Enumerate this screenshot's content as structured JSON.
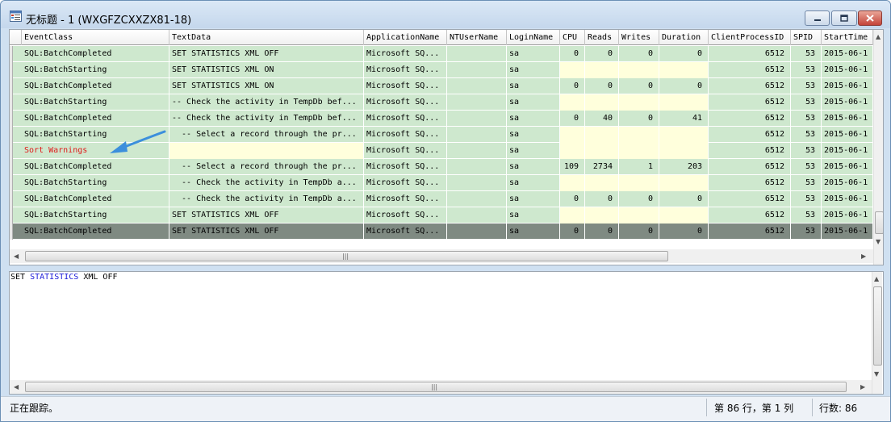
{
  "window": {
    "title": "无标题 - 1 (WXGFZCXXZX81-18)"
  },
  "columns": [
    "EventClass",
    "TextData",
    "ApplicationName",
    "NTUserName",
    "LoginName",
    "CPU",
    "Reads",
    "Writes",
    "Duration",
    "ClientProcessID",
    "SPID",
    "StartTime"
  ],
  "rows": [
    {
      "event": "SQL:BatchCompleted",
      "text": "SET STATISTICS XML OFF",
      "app": "Microsoft SQ...",
      "nt": "",
      "login": "sa",
      "cpu": "0",
      "reads": "0",
      "writes": "0",
      "duration": "0",
      "pid": "6512",
      "spid": "53",
      "start": "2015-06-1"
    },
    {
      "event": "SQL:BatchStarting",
      "text": "SET STATISTICS XML ON",
      "app": "Microsoft SQ...",
      "nt": "",
      "login": "sa",
      "cpu": "",
      "reads": "",
      "writes": "",
      "duration": "",
      "pid": "6512",
      "spid": "53",
      "start": "2015-06-1"
    },
    {
      "event": "SQL:BatchCompleted",
      "text": "SET STATISTICS XML ON",
      "app": "Microsoft SQ...",
      "nt": "",
      "login": "sa",
      "cpu": "0",
      "reads": "0",
      "writes": "0",
      "duration": "0",
      "pid": "6512",
      "spid": "53",
      "start": "2015-06-1"
    },
    {
      "event": "SQL:BatchStarting",
      "text": "-- Check the activity in TempDb bef...",
      "app": "Microsoft SQ...",
      "nt": "",
      "login": "sa",
      "cpu": "",
      "reads": "",
      "writes": "",
      "duration": "",
      "pid": "6512",
      "spid": "53",
      "start": "2015-06-1"
    },
    {
      "event": "SQL:BatchCompleted",
      "text": "-- Check the activity in TempDb bef...",
      "app": "Microsoft SQ...",
      "nt": "",
      "login": "sa",
      "cpu": "0",
      "reads": "40",
      "writes": "0",
      "duration": "41",
      "pid": "6512",
      "spid": "53",
      "start": "2015-06-1"
    },
    {
      "event": "SQL:BatchStarting",
      "text": "  -- Select a record through the pr...",
      "app": "Microsoft SQ...",
      "nt": "",
      "login": "sa",
      "cpu": "",
      "reads": "",
      "writes": "",
      "duration": "",
      "pid": "6512",
      "spid": "53",
      "start": "2015-06-1"
    },
    {
      "event": "Sort Warnings",
      "text": "",
      "app": "Microsoft SQ...",
      "nt": "",
      "login": "sa",
      "cpu": "",
      "reads": "",
      "writes": "",
      "duration": "",
      "pid": "6512",
      "spid": "53",
      "start": "2015-06-1"
    },
    {
      "event": "SQL:BatchCompleted",
      "text": "  -- Select a record through the pr...",
      "app": "Microsoft SQ...",
      "nt": "",
      "login": "sa",
      "cpu": "109",
      "reads": "2734",
      "writes": "1",
      "duration": "203",
      "pid": "6512",
      "spid": "53",
      "start": "2015-06-1"
    },
    {
      "event": "SQL:BatchStarting",
      "text": "  -- Check the activity in TempDb a...",
      "app": "Microsoft SQ...",
      "nt": "",
      "login": "sa",
      "cpu": "",
      "reads": "",
      "writes": "",
      "duration": "",
      "pid": "6512",
      "spid": "53",
      "start": "2015-06-1"
    },
    {
      "event": "SQL:BatchCompleted",
      "text": "  -- Check the activity in TempDb a...",
      "app": "Microsoft SQ...",
      "nt": "",
      "login": "sa",
      "cpu": "0",
      "reads": "0",
      "writes": "0",
      "duration": "0",
      "pid": "6512",
      "spid": "53",
      "start": "2015-06-1"
    },
    {
      "event": "SQL:BatchStarting",
      "text": "SET STATISTICS XML OFF",
      "app": "Microsoft SQ...",
      "nt": "",
      "login": "sa",
      "cpu": "",
      "reads": "",
      "writes": "",
      "duration": "",
      "pid": "6512",
      "spid": "53",
      "start": "2015-06-1"
    },
    {
      "event": "SQL:BatchCompleted",
      "text": "SET STATISTICS XML OFF",
      "app": "Microsoft SQ...",
      "nt": "",
      "login": "sa",
      "cpu": "0",
      "reads": "0",
      "writes": "0",
      "duration": "0",
      "pid": "6512",
      "spid": "53",
      "start": "2015-06-1"
    }
  ],
  "selected_row_index": 11,
  "warning_row_index": 6,
  "textpane": {
    "word1": "SET",
    "word2": "STATISTICS",
    "word3": "XML OFF"
  },
  "status": {
    "message": "正在跟踪。",
    "position": "第 86 行，第 1 列",
    "row_count": "行数: 86"
  },
  "colors": {
    "row_bg": "#cee8ce",
    "selected_bg": "#7f8a82",
    "empty_cell_bg": "#ffffdc",
    "warning_text": "#e01a1a",
    "annotation_arrow": "#3c8fdc",
    "keyword": "#1b1bd9"
  },
  "annotation": {
    "icon": "annotation-arrow-icon"
  }
}
